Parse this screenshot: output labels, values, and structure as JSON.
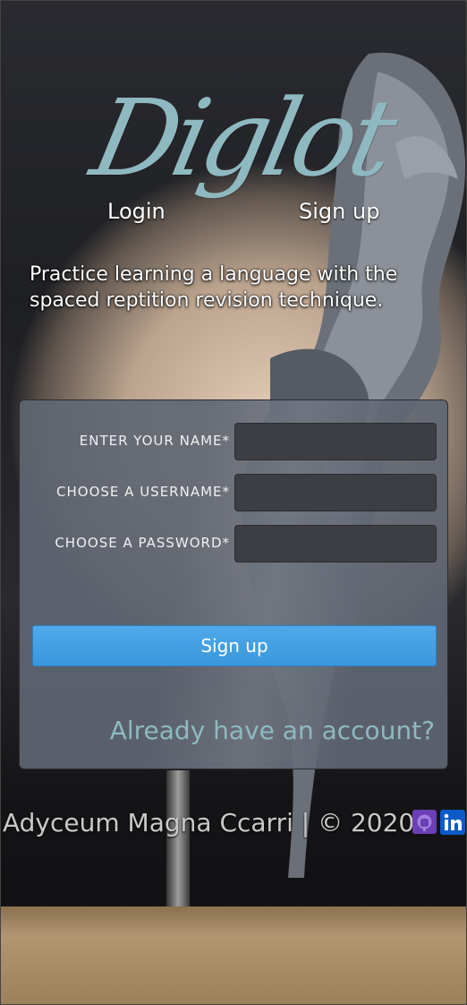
{
  "header": {
    "logo": "Diglot",
    "nav": {
      "login_label": "Login",
      "signup_label": "Sign up"
    },
    "tagline": "Practice learning a language with the spaced reptition revision technique."
  },
  "form": {
    "fields": [
      {
        "label": "ENTER YOUR NAME*",
        "value": ""
      },
      {
        "label": "CHOOSE A USERNAME*",
        "value": ""
      },
      {
        "label": "CHOOSE A PASSWORD*",
        "value": ""
      }
    ],
    "submit_label": "Sign up",
    "login_link": "Already have an account?"
  },
  "footer": {
    "text": "Adyceum Magna Ccarri | © 2020",
    "icons": [
      "github-icon",
      "linkedin-icon"
    ]
  },
  "colors": {
    "accent": "#8fb9c0",
    "button": "#4fa9ea",
    "github": "#6b3fb5",
    "linkedin": "#0a5bc7"
  }
}
